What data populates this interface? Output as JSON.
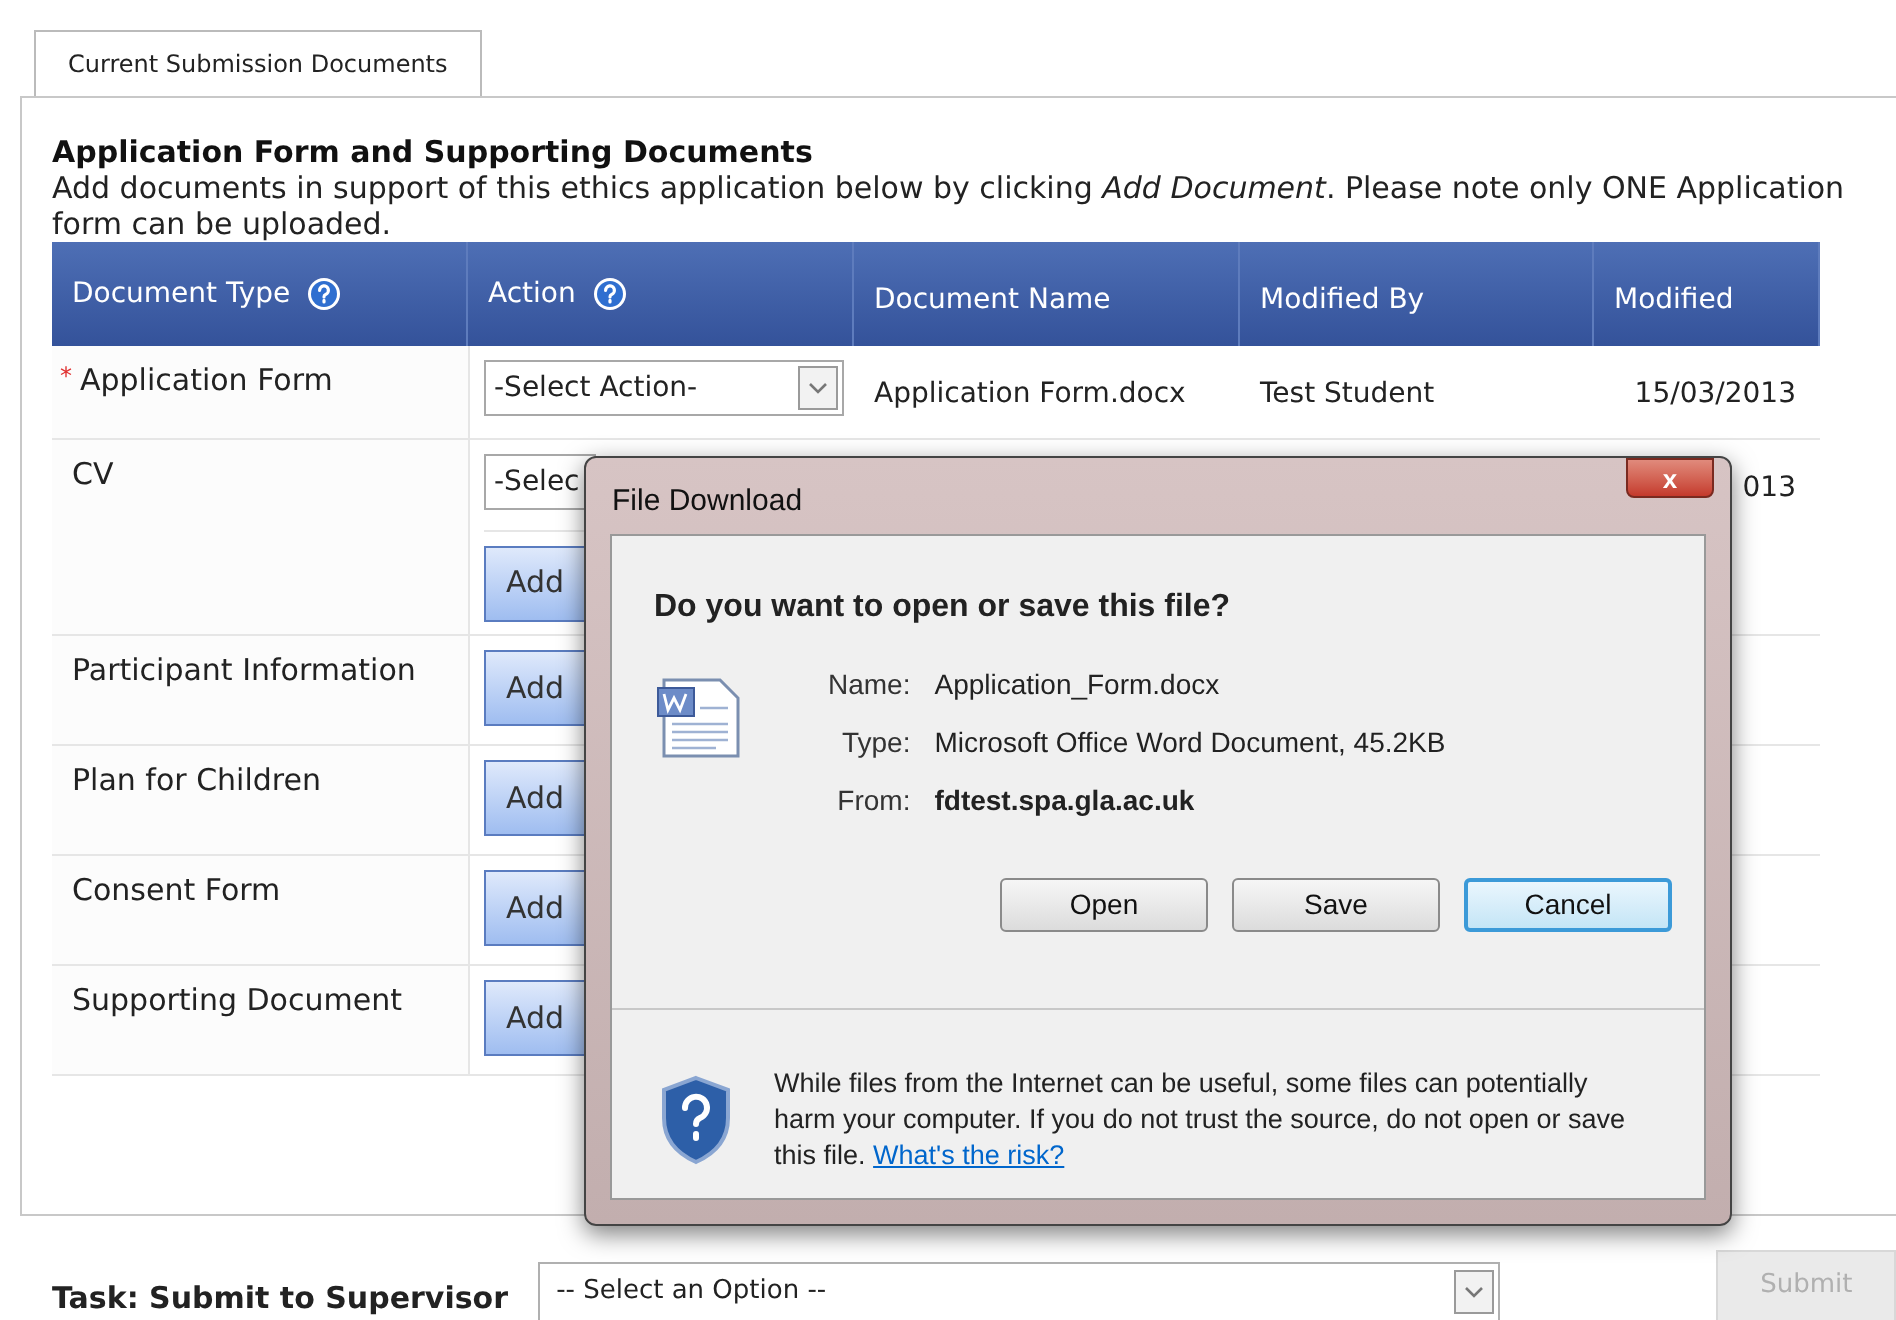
{
  "tabs": [
    {
      "label": "Current Submission Documents",
      "selected": true
    }
  ],
  "section": {
    "title": "Application Form and Supporting Documents",
    "description": "Add documents in support of this ethics application below by clicking *Add Document*. Please note only ONE Application form can be uploaded."
  },
  "table": {
    "required_marker": "*",
    "columns": [
      {
        "label": "Document Type",
        "help": true
      },
      {
        "label": "Action",
        "help": true
      },
      {
        "label": "Document Name",
        "help": false
      },
      {
        "label": "Modified By",
        "help": false
      },
      {
        "label": "Modified",
        "help": false
      }
    ],
    "rows": [
      {
        "type": "Application Form",
        "required": true,
        "actions": [
          {
            "kind": "select",
            "text": "-Select Action-",
            "arrow": true
          }
        ],
        "document_name": "Application Form.docx",
        "modified_by": "Test Student",
        "modified": "15/03/2013"
      },
      {
        "type": "CV",
        "required": false,
        "actions": [
          {
            "kind": "select",
            "text": "-Selec",
            "arrow": false
          },
          {
            "kind": "button",
            "text": "Add"
          }
        ],
        "modified": "013"
      },
      {
        "type": "Participant Information",
        "required": false,
        "actions": [
          {
            "kind": "button",
            "text": "Add"
          }
        ]
      },
      {
        "type": "Plan for Children",
        "required": false,
        "actions": [
          {
            "kind": "button",
            "text": "Add"
          }
        ]
      },
      {
        "type": "Consent Form",
        "required": false,
        "actions": [
          {
            "kind": "button",
            "text": "Add"
          }
        ]
      },
      {
        "type": "Supporting Document",
        "required": false,
        "actions": [
          {
            "kind": "button",
            "text": "Add"
          }
        ]
      }
    ]
  },
  "dialog": {
    "title": "File Download",
    "close": "x",
    "question": "Do you want to open or save this file?",
    "fields": [
      {
        "label": "Name:",
        "value": "Application_Form.docx",
        "bold": false
      },
      {
        "label": "Type:",
        "value": "Microsoft Office Word Document, 45.2KB",
        "bold": false
      },
      {
        "label": "From:",
        "value": "fdtest.spa.gla.ac.uk",
        "bold": true
      }
    ],
    "buttons": [
      {
        "label": "Open",
        "focused": false
      },
      {
        "label": "Save",
        "focused": false
      },
      {
        "label": "Cancel",
        "focused": true
      }
    ],
    "warning": "While files from the Internet can be useful, some files can potentially harm your computer. If you do not trust the source, do not open or save this file.",
    "warning_link": "What's the risk?"
  },
  "task": {
    "label": "Task: Submit to Supervisor",
    "select": "-- Select an Option --",
    "submit": {
      "label": "Submit",
      "disabled": true
    }
  }
}
